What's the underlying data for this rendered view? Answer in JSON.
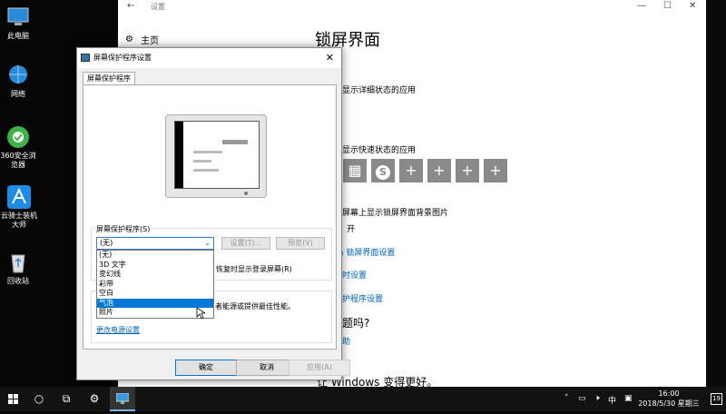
{
  "desktop": {
    "icons": [
      {
        "label": "此电脑",
        "icon": "computer-icon"
      },
      {
        "label": "网络",
        "icon": "network-icon"
      },
      {
        "label": "360安全浏览器",
        "icon": "360-browser-icon"
      },
      {
        "label": "云骑士装机大师",
        "icon": "yunqishi-icon"
      },
      {
        "label": "回收站",
        "icon": "recycle-bin-icon"
      }
    ]
  },
  "settings": {
    "app_title": "设置",
    "home": "主页",
    "page_title": "锁屏界面",
    "detail_status": "显示详细状态的应用",
    "quick_status": "显示快速状态的应用",
    "bg_on_signin": "屏幕上显示锁屏界面背景图片",
    "toggle_state": "开",
    "link_cortana": "a 锁屏界面设置",
    "link_timeout": "时设置",
    "link_screensaver": "护程序设置",
    "question": "题吗?",
    "help_link": "助",
    "bottom_text": "让 Windows 变得更好。"
  },
  "dialog": {
    "title": "屏幕保护程序设置",
    "tab": "屏幕保护程序",
    "group_label": "屏幕保护程序(S)",
    "combo_value": "(无)",
    "settings_btn": "设置(T)...",
    "preview_btn": "预览(V)",
    "resume_text": "恢复时显示登录屏幕(R)",
    "power_text": "者能源或提供最佳性能。",
    "power_link": "更改电源设置",
    "options": [
      "(无)",
      "3D 文字",
      "变幻线",
      "彩带",
      "空白",
      "气泡",
      "照片"
    ],
    "selected_option": "气泡",
    "ok": "确定",
    "cancel": "取消",
    "apply": "应用(A)"
  },
  "taskbar": {
    "start": "start-icon",
    "time": "16:00",
    "date": "2018/5/30 星期三",
    "ime": "中",
    "notifications": "19"
  }
}
